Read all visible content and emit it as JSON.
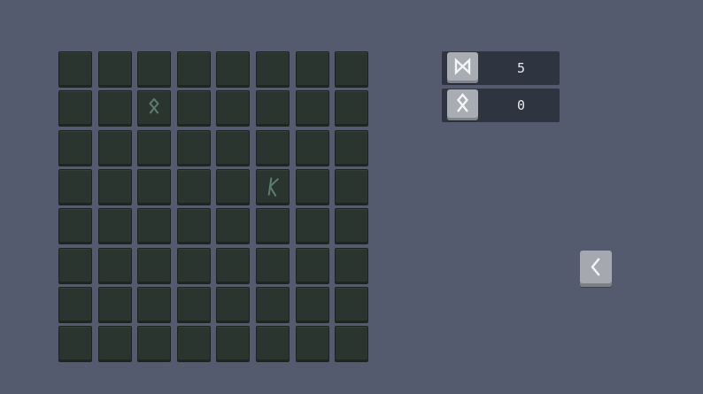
{
  "board": {
    "rows": 8,
    "cols": 8,
    "tile_color": "#2b352f",
    "rune_color": "#5f7c73",
    "revealed": [
      {
        "row": 1,
        "col": 2,
        "rune": "othala-rune-icon"
      },
      {
        "row": 3,
        "col": 5,
        "rune": "kaunan-rune-icon"
      }
    ]
  },
  "counters": [
    {
      "icon": "dagaz-rune-icon",
      "value": "5"
    },
    {
      "icon": "othala-rune-icon",
      "value": "0"
    }
  ],
  "back_button": {
    "icon": "chevron-left-icon"
  }
}
